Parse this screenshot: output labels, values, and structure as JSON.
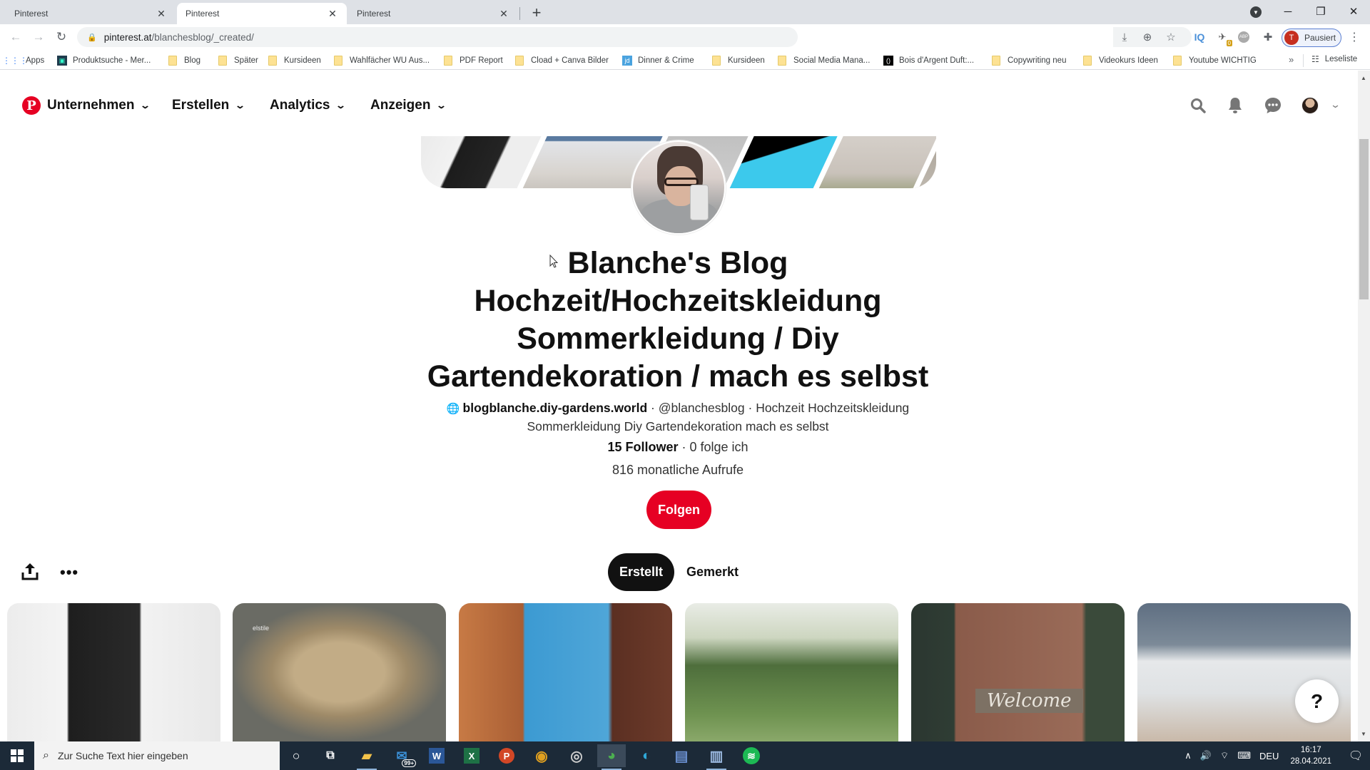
{
  "browser": {
    "tabs": [
      {
        "label": "Pinterest",
        "active": false
      },
      {
        "label": "Pinterest",
        "active": true
      },
      {
        "label": "Pinterest",
        "active": false
      }
    ],
    "new_tab_icon": "plus-icon",
    "address": {
      "host": "pinterest.at",
      "path": "/blanchesblog/_created/"
    },
    "profile_button": {
      "initial": "T",
      "label": "Pausiert"
    },
    "extensions": [
      {
        "name": "iq-extension",
        "glyph": "IQ",
        "color": "#4a90d9"
      },
      {
        "name": "bird-extension",
        "glyph": "✈",
        "badge": "0"
      },
      {
        "name": "adblock-plus-extension",
        "glyph": "ABP"
      },
      {
        "name": "extensions-puzzle",
        "glyph": "✚"
      }
    ],
    "bookmarks": [
      {
        "label": "Apps",
        "type": "apps"
      },
      {
        "label": "Produktsuche - Mer...",
        "type": "site"
      },
      {
        "label": "Blog",
        "type": "folder"
      },
      {
        "label": "Später",
        "type": "folder"
      },
      {
        "label": "Kursideen",
        "type": "folder"
      },
      {
        "label": "Wahlfächer WU Aus...",
        "type": "folder"
      },
      {
        "label": "PDF Report",
        "type": "folder"
      },
      {
        "label": "Cload + Canva Bilder",
        "type": "folder"
      },
      {
        "label": "Dinner & Crime",
        "type": "site-jd"
      },
      {
        "label": "Kursideen",
        "type": "folder"
      },
      {
        "label": "Social Media Mana...",
        "type": "folder"
      },
      {
        "label": "Bois d'Argent Duft:...",
        "type": "site-black"
      },
      {
        "label": "Copywriting neu",
        "type": "folder"
      },
      {
        "label": "Videokurs Ideen",
        "type": "folder"
      },
      {
        "label": "Youtube WICHTIG",
        "type": "folder"
      }
    ],
    "bookmarks_overflow": "»",
    "reading_list": "Leseliste"
  },
  "pinterest": {
    "nav": [
      {
        "label": "Unternehmen"
      },
      {
        "label": "Erstellen"
      },
      {
        "label": "Analytics"
      },
      {
        "label": "Anzeigen"
      }
    ],
    "profile": {
      "title": "Blanche's Blog Hochzeit/Hochzeitskleidung Sommerkleidung / Diy Gartendekoration / mach es selbst",
      "website": "blogblanche.diy-gardens.world",
      "handle": "@blanchesblog",
      "about": "Hochzeit Hochzeitskleidung Sommerkleidung Diy Gartendekoration mach es selbst",
      "followers": "15 Follower",
      "following": "0 folge ich",
      "monthly_views": "816 monatliche Aufrufe",
      "follow_button": "Folgen",
      "separator": " · "
    },
    "tabs": [
      {
        "label": "Erstellt",
        "active": true
      },
      {
        "label": "Gemerkt",
        "active": false
      }
    ],
    "pins": [
      {
        "name": "black-polka-dot-dress",
        "colors": [
          "#f1f1f1",
          "#e4e4e4",
          "#1b1b1b"
        ]
      },
      {
        "name": "braided-hairstyle",
        "colors": [
          "#6e6e66",
          "#a08a6a",
          "#c4b49a"
        ],
        "overlay_text": "elstile"
      },
      {
        "name": "woman-with-umbrella",
        "colors": [
          "#3f9ad0",
          "#8a4b2c",
          "#d08a55"
        ]
      },
      {
        "name": "garden-wedding",
        "colors": [
          "#eef0ea",
          "#4c6a3a",
          "#7ea05a"
        ]
      },
      {
        "name": "welcome-sign",
        "colors": [
          "#2f3a33",
          "#8a5a4a",
          "#a38f7a"
        ],
        "overlay_text": "Welcome"
      },
      {
        "name": "bride-at-lake",
        "colors": [
          "#6d7a8a",
          "#e4e7ea",
          "#c9b9a9"
        ]
      }
    ],
    "help_button": "?"
  },
  "taskbar": {
    "search_placeholder": "Zur Suche Text hier eingeben",
    "apps": [
      {
        "name": "cortana",
        "glyph": "○"
      },
      {
        "name": "task-view",
        "glyph": "⧉"
      },
      {
        "name": "file-explorer",
        "glyph": "▰",
        "color": "#f2c24a"
      },
      {
        "name": "mail",
        "glyph": "✉",
        "color": "#3a8fd6",
        "badge": "99+"
      },
      {
        "name": "word",
        "glyph": "W",
        "color": "#2b5797"
      },
      {
        "name": "excel",
        "glyph": "X",
        "color": "#1e7145"
      },
      {
        "name": "powerpoint",
        "glyph": "P",
        "color": "#d24726"
      },
      {
        "name": "app-colorful",
        "glyph": "◉",
        "color": "#e0a020"
      },
      {
        "name": "obs",
        "glyph": "◎",
        "color": "#cccccc"
      },
      {
        "name": "chrome",
        "glyph": "◕",
        "color": "#4caf50",
        "active": true
      },
      {
        "name": "edge",
        "glyph": "◐",
        "color": "#2fa8d8"
      },
      {
        "name": "app-document",
        "glyph": "▤",
        "color": "#6a8fcf"
      },
      {
        "name": "app-image",
        "glyph": "▥",
        "color": "#9ab8e0"
      },
      {
        "name": "spotify",
        "glyph": "≋",
        "color": "#1db954"
      }
    ],
    "tray": {
      "language": "DEU",
      "time": "16:17",
      "date": "28.04.2021"
    }
  }
}
